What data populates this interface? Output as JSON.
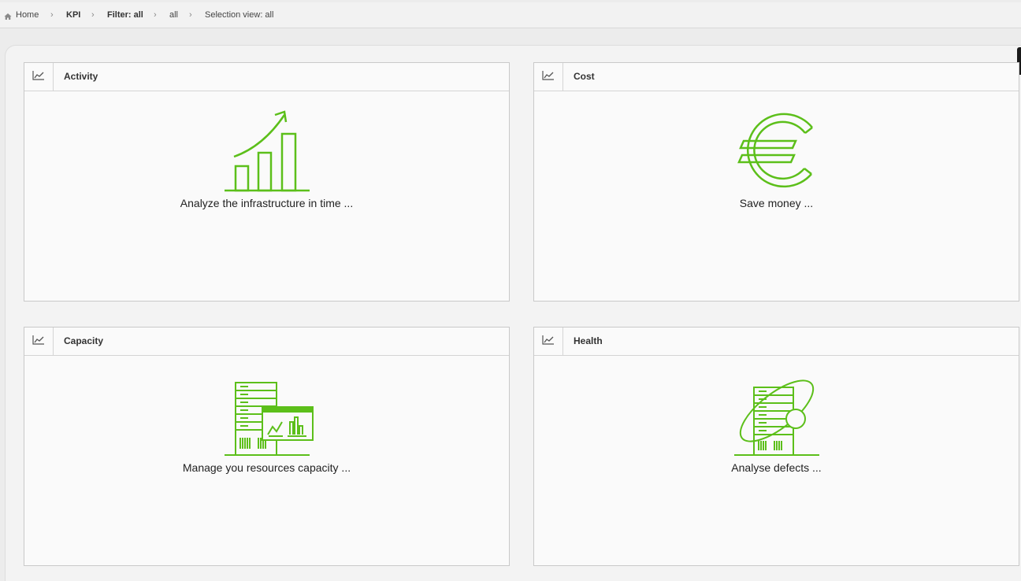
{
  "breadcrumb": {
    "home": "Home",
    "kpi": "KPI",
    "filter": "Filter: all",
    "all": "all",
    "selection": "Selection view: all",
    "separator": "›"
  },
  "colors": {
    "accent": "#5cbf1a"
  },
  "cards": [
    {
      "title": "Activity",
      "description": "Analyze the infrastructure in time ...",
      "icon": "growth-bar-chart-icon"
    },
    {
      "title": "Cost",
      "description": "Save money ...",
      "icon": "euro-icon"
    },
    {
      "title": "Capacity",
      "description": "Manage you resources capacity ...",
      "icon": "server-monitor-icon"
    },
    {
      "title": "Health",
      "description": "Analyse defects ...",
      "icon": "server-orbit-icon"
    }
  ]
}
